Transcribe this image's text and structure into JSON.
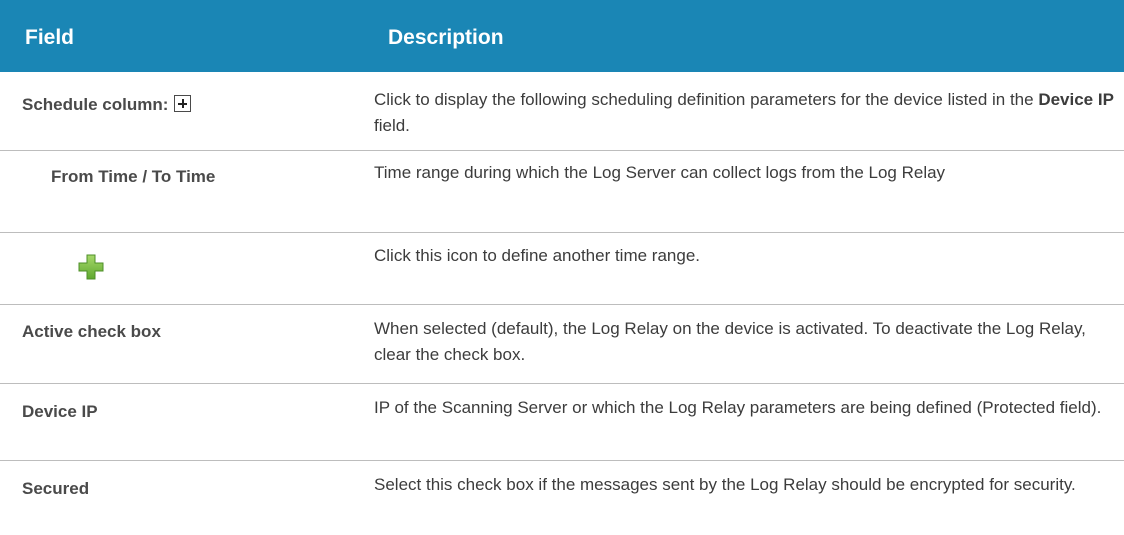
{
  "header": {
    "field": "Field",
    "description": "Description"
  },
  "rows": [
    {
      "field": "Schedule column:",
      "field_icon": "expand-box-icon",
      "desc_pre": "Click to display the following scheduling definition parameters for the device listed in the ",
      "desc_bold": "Device IP",
      "desc_post": " field."
    },
    {
      "field": "From Time / To Time",
      "desc": "Time range during which the Log Server can collect logs from the Log Relay"
    },
    {
      "field_icon": "green-plus-icon",
      "desc": "Click this icon to define another time range."
    },
    {
      "field": "Active check box",
      "desc": "When selected (default), the Log Relay on the device is activated. To deactivate the Log Relay, clear the check box."
    },
    {
      "field": "Device IP",
      "desc": "IP of the Scanning Server or which the Log Relay parameters are being defined (Protected field)."
    },
    {
      "field": "Secured",
      "desc": "Select this check box if the messages sent by the Log Relay should be encrypted for security."
    }
  ],
  "colors": {
    "header_bg": "#1a86b5",
    "header_text": "#ffffff",
    "divider": "#bdbdbd",
    "plus_green": "#7cc242"
  }
}
